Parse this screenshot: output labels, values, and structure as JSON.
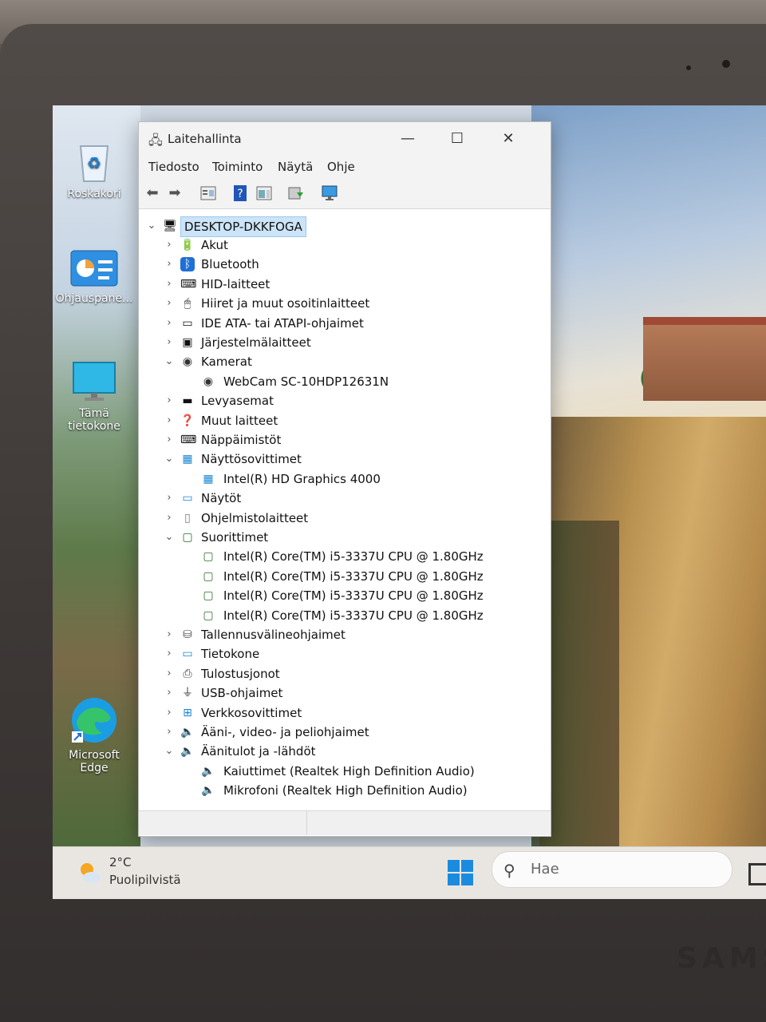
{
  "window": {
    "title": "Laitehallinta",
    "controls": {
      "minimize": "—",
      "maximize": "☐",
      "close": "✕"
    }
  },
  "menu": [
    "Tiedosto",
    "Toiminto",
    "Näytä",
    "Ohje"
  ],
  "toolbar_icons": [
    "back-icon",
    "forward-icon",
    "properties-icon",
    "help-icon",
    "view-icon",
    "update-driver-icon",
    "monitor-icon"
  ],
  "tree": {
    "root": "DESKTOP-DKKFOGA",
    "nodes": [
      {
        "label": "Akut",
        "expanded": false,
        "icon": "battery-icon"
      },
      {
        "label": "Bluetooth",
        "expanded": false,
        "icon": "bluetooth-icon"
      },
      {
        "label": "HID-laitteet",
        "expanded": false,
        "icon": "hid-icon"
      },
      {
        "label": "Hiiret ja muut osoitinlaitteet",
        "expanded": false,
        "icon": "mouse-icon"
      },
      {
        "label": "IDE ATA- tai ATAPI-ohjaimet",
        "expanded": false,
        "icon": "ide-icon"
      },
      {
        "label": "Järjestelmälaitteet",
        "expanded": false,
        "icon": "system-icon"
      },
      {
        "label": "Kamerat",
        "expanded": true,
        "icon": "camera-icon",
        "children": [
          "WebCam SC-10HDP12631N"
        ]
      },
      {
        "label": "Levyasemat",
        "expanded": false,
        "icon": "disk-icon"
      },
      {
        "label": "Muut laitteet",
        "expanded": false,
        "icon": "other-device-icon"
      },
      {
        "label": "Näppäimistöt",
        "expanded": false,
        "icon": "keyboard-icon"
      },
      {
        "label": "Näyttösovittimet",
        "expanded": true,
        "icon": "display-adapter-icon",
        "children": [
          "Intel(R) HD Graphics 4000"
        ]
      },
      {
        "label": "Näytöt",
        "expanded": false,
        "icon": "monitor-icon"
      },
      {
        "label": "Ohjelmistolaitteet",
        "expanded": false,
        "icon": "software-icon"
      },
      {
        "label": "Suorittimet",
        "expanded": true,
        "icon": "cpu-icon",
        "children": [
          "Intel(R) Core(TM) i5-3337U CPU @ 1.80GHz",
          "Intel(R) Core(TM) i5-3337U CPU @ 1.80GHz",
          "Intel(R) Core(TM) i5-3337U CPU @ 1.80GHz",
          "Intel(R) Core(TM) i5-3337U CPU @ 1.80GHz"
        ]
      },
      {
        "label": "Tallennusvälineohjaimet",
        "expanded": false,
        "icon": "storage-icon"
      },
      {
        "label": "Tietokone",
        "expanded": false,
        "icon": "computer-icon"
      },
      {
        "label": "Tulostusjonot",
        "expanded": false,
        "icon": "printer-icon"
      },
      {
        "label": "USB-ohjaimet",
        "expanded": false,
        "icon": "usb-icon"
      },
      {
        "label": "Verkkosovittimet",
        "expanded": false,
        "icon": "network-icon"
      },
      {
        "label": "Ääni-, video- ja peliohjaimet",
        "expanded": false,
        "icon": "speaker-icon"
      },
      {
        "label": "Äänitulot ja -lähdöt",
        "expanded": true,
        "icon": "speaker-icon",
        "children": [
          "Kaiuttimet (Realtek High Definition Audio)",
          "Mikrofoni (Realtek High Definition Audio)"
        ]
      }
    ]
  },
  "desktop_icons": [
    {
      "label": "Roskakori",
      "icon": "recycle-bin-icon"
    },
    {
      "label": "Ohjauspane...",
      "icon": "control-panel-icon"
    },
    {
      "label": "Tämä tietokone",
      "icon": "this-pc-icon"
    },
    {
      "label": "Microsoft Edge",
      "icon": "edge-icon"
    }
  ],
  "taskbar": {
    "temperature": "2°C",
    "weather": "Puolipilvistä",
    "search_placeholder": "Hae"
  },
  "brand": "SAMS",
  "colors": {
    "selection": "#cce4f7",
    "accent": "#0078d4"
  }
}
